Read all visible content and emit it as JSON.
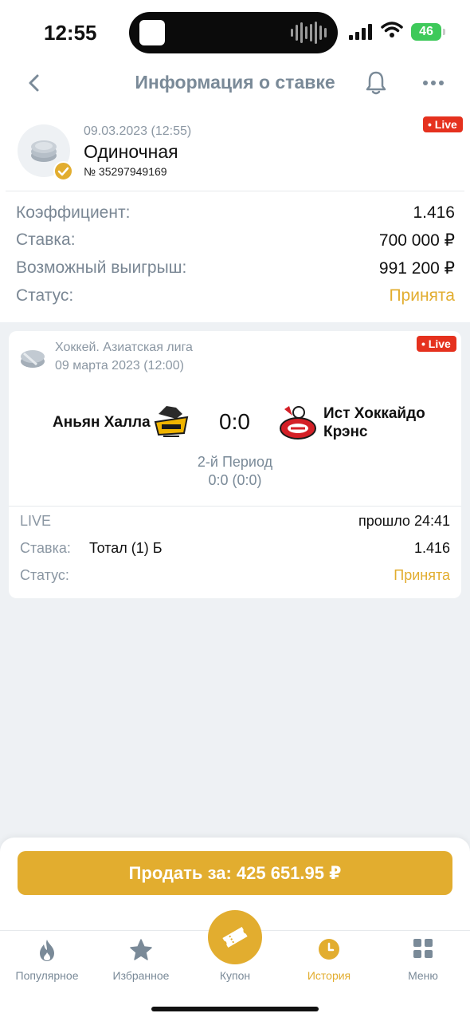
{
  "status_bar": {
    "time": "12:55",
    "battery": "46"
  },
  "header": {
    "title": "Информация о ставке"
  },
  "bet": {
    "date": "09.03.2023 (12:55)",
    "type": "Одиночная",
    "number": "№ 35297949169",
    "live_badge": "• Live",
    "rows": [
      {
        "label": "Коэффициент:",
        "value": "1.416"
      },
      {
        "label": "Ставка:",
        "value": "700 000 ₽"
      },
      {
        "label": "Возможный выигрыш:",
        "value": "991 200 ₽"
      },
      {
        "label": "Статус:",
        "value": "Принята"
      }
    ]
  },
  "event": {
    "league": "Хоккей. Азиатская лига",
    "date": "09 марта 2023 (12:00)",
    "live_badge": "• Live",
    "team1": "Аньян Халла",
    "team2": "Ист Хоккайдо Крэнс",
    "score": "0:0",
    "period": "2-й Период",
    "period_score": "0:0 (0:0)",
    "live_label": "LIVE",
    "elapsed": "прошло 24:41",
    "stake_label": "Ставка:",
    "stake_market": "Тотал (1) Б",
    "stake_odds": "1.416",
    "status_label": "Статус:",
    "status_value": "Принята"
  },
  "sell": {
    "label": "Продать за: 425 651.95 ₽"
  },
  "tabbar": {
    "items": [
      {
        "label": "Популярное",
        "icon": "flame-icon"
      },
      {
        "label": "Избранное",
        "icon": "star-icon"
      },
      {
        "label": "Купон",
        "icon": "ticket-icon"
      },
      {
        "label": "История",
        "icon": "clock-icon",
        "active": true
      },
      {
        "label": "Меню",
        "icon": "grid-icon"
      }
    ]
  },
  "colors": {
    "accent": "#e2ad2f",
    "live": "#e5311e",
    "muted": "#7a8a98"
  }
}
